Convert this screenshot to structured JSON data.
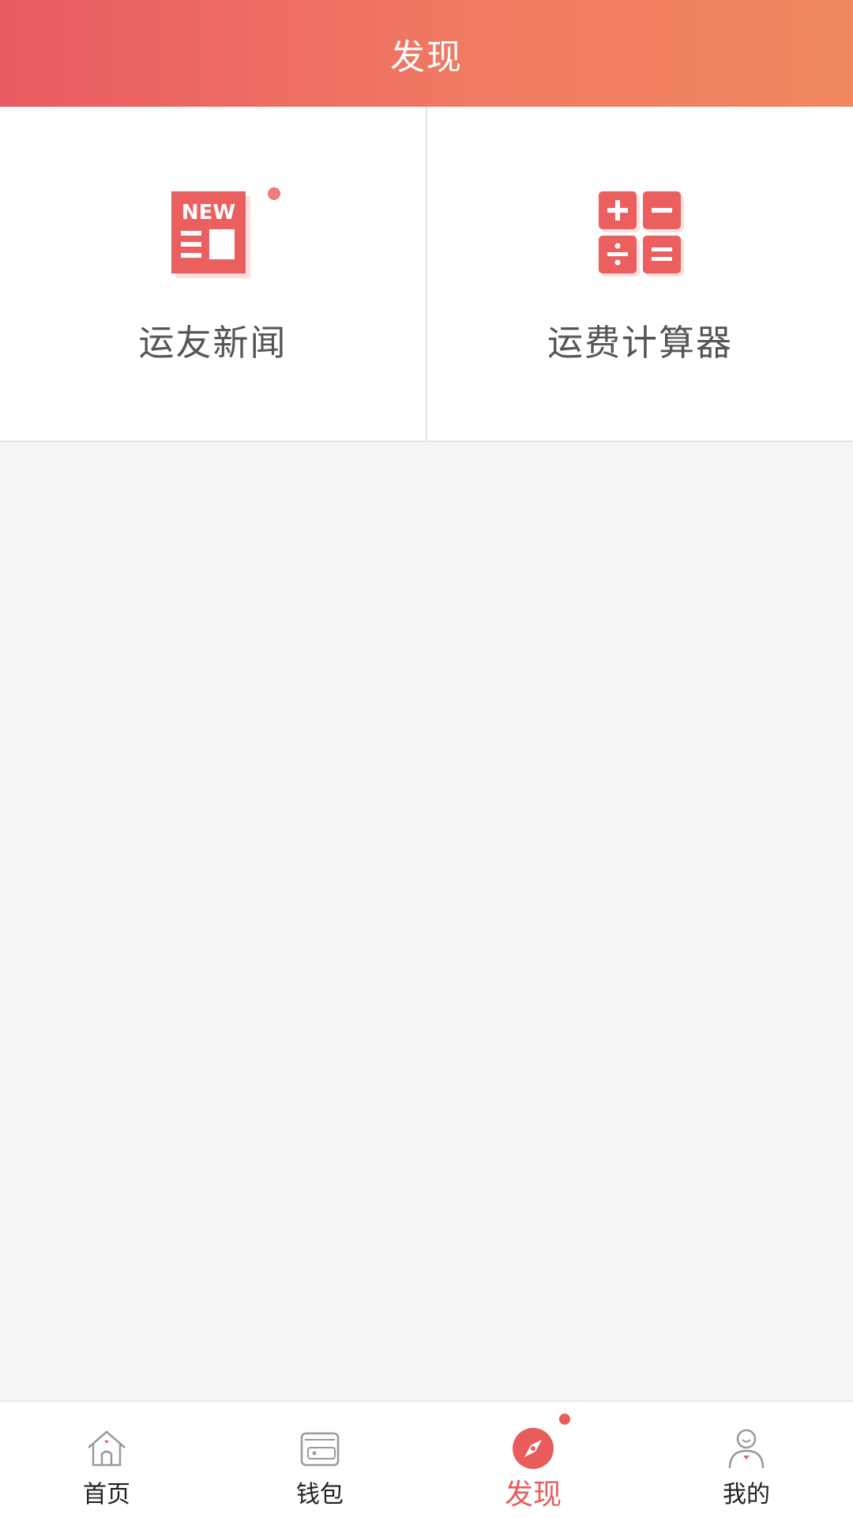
{
  "header": {
    "title": "发现"
  },
  "tiles": [
    {
      "label": "运友新闻",
      "icon": "news-icon",
      "icon_text": "NEW",
      "has_badge": true
    },
    {
      "label": "运费计算器",
      "icon": "calculator-icon",
      "has_badge": false
    }
  ],
  "tabbar": {
    "items": [
      {
        "label": "首页",
        "icon": "home-icon",
        "active": false
      },
      {
        "label": "钱包",
        "icon": "wallet-icon",
        "active": false
      },
      {
        "label": "发现",
        "icon": "compass-icon",
        "active": true,
        "has_badge": true
      },
      {
        "label": "我的",
        "icon": "user-icon",
        "active": false
      }
    ]
  },
  "colors": {
    "brand": "#ea5a62",
    "brand_gradient_end": "#f0875d",
    "icon_red": "#ec5f5f",
    "badge": "#ee7c7c",
    "tab_active": "#e85c5c",
    "page_bg": "#f5f5f5"
  }
}
